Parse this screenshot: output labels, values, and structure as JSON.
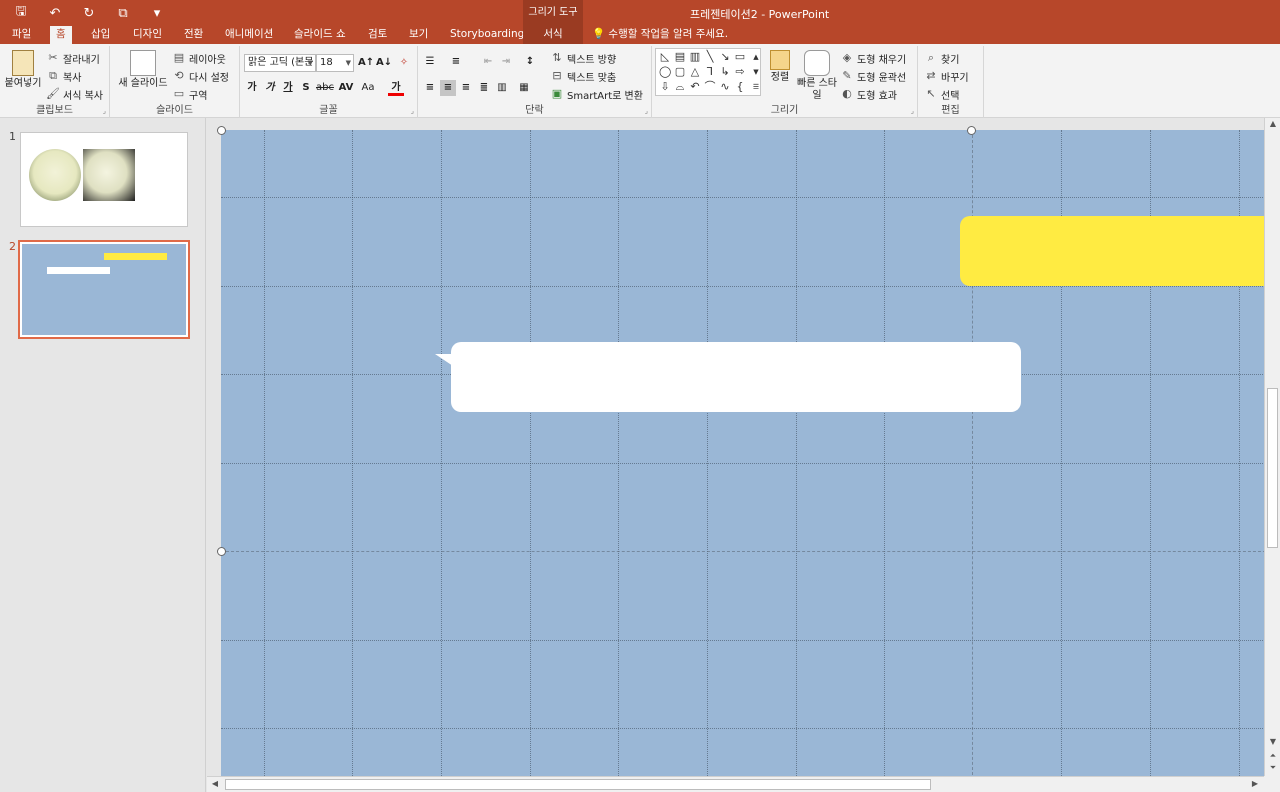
{
  "window": {
    "title": "프레젠테이션2 - PowerPoint",
    "context_header": "그리기 도구"
  },
  "qat": {
    "save": "🖫",
    "undo": "↶",
    "redo": "↻",
    "present": "⧉",
    "customize": "▾"
  },
  "tabs": [
    "파일",
    "홈",
    "삽입",
    "디자인",
    "전환",
    "애니메이션",
    "슬라이드 쇼",
    "검토",
    "보기",
    "Storyboarding",
    "서식"
  ],
  "active_tab": "홈",
  "tell_me": "수행할 작업을 알려 주세요.",
  "ribbon": {
    "clipboard": {
      "label": "클립보드",
      "paste": "붙여넣기",
      "cut": "잘라내기",
      "copy": "복사",
      "format_painter": "서식 복사"
    },
    "slides": {
      "label": "슬라이드",
      "new_slide": "새 슬라이드",
      "layout": "레이아웃",
      "reset": "다시 설정",
      "section": "구역"
    },
    "font": {
      "label": "글꼴",
      "font_name": "맑은 고딕 (본문",
      "font_size": "18",
      "bold": "가",
      "italic": "가",
      "underline": "가",
      "shadow": "S",
      "strike": "abc",
      "spacing": "AV",
      "case": "Aa",
      "color": "가"
    },
    "paragraph": {
      "label": "단락",
      "text_direction": "텍스트 방향",
      "align_text": "텍스트 맞춤",
      "smartart": "SmartArt로 변환"
    },
    "drawing": {
      "label": "그리기",
      "arrange": "정렬",
      "quick_styles": "빠른 스타일",
      "fill": "도형 채우기",
      "outline": "도형 윤곽선",
      "effects": "도형 효과"
    },
    "editing": {
      "label": "편집",
      "find": "찾기",
      "replace": "바꾸기",
      "select": "선택"
    }
  },
  "slides": [
    {
      "number": "1"
    },
    {
      "number": "2"
    }
  ],
  "colors": {
    "accent": "#b7472a",
    "slide_bg": "#9ab7d6",
    "yellow": "#ffeb42"
  }
}
